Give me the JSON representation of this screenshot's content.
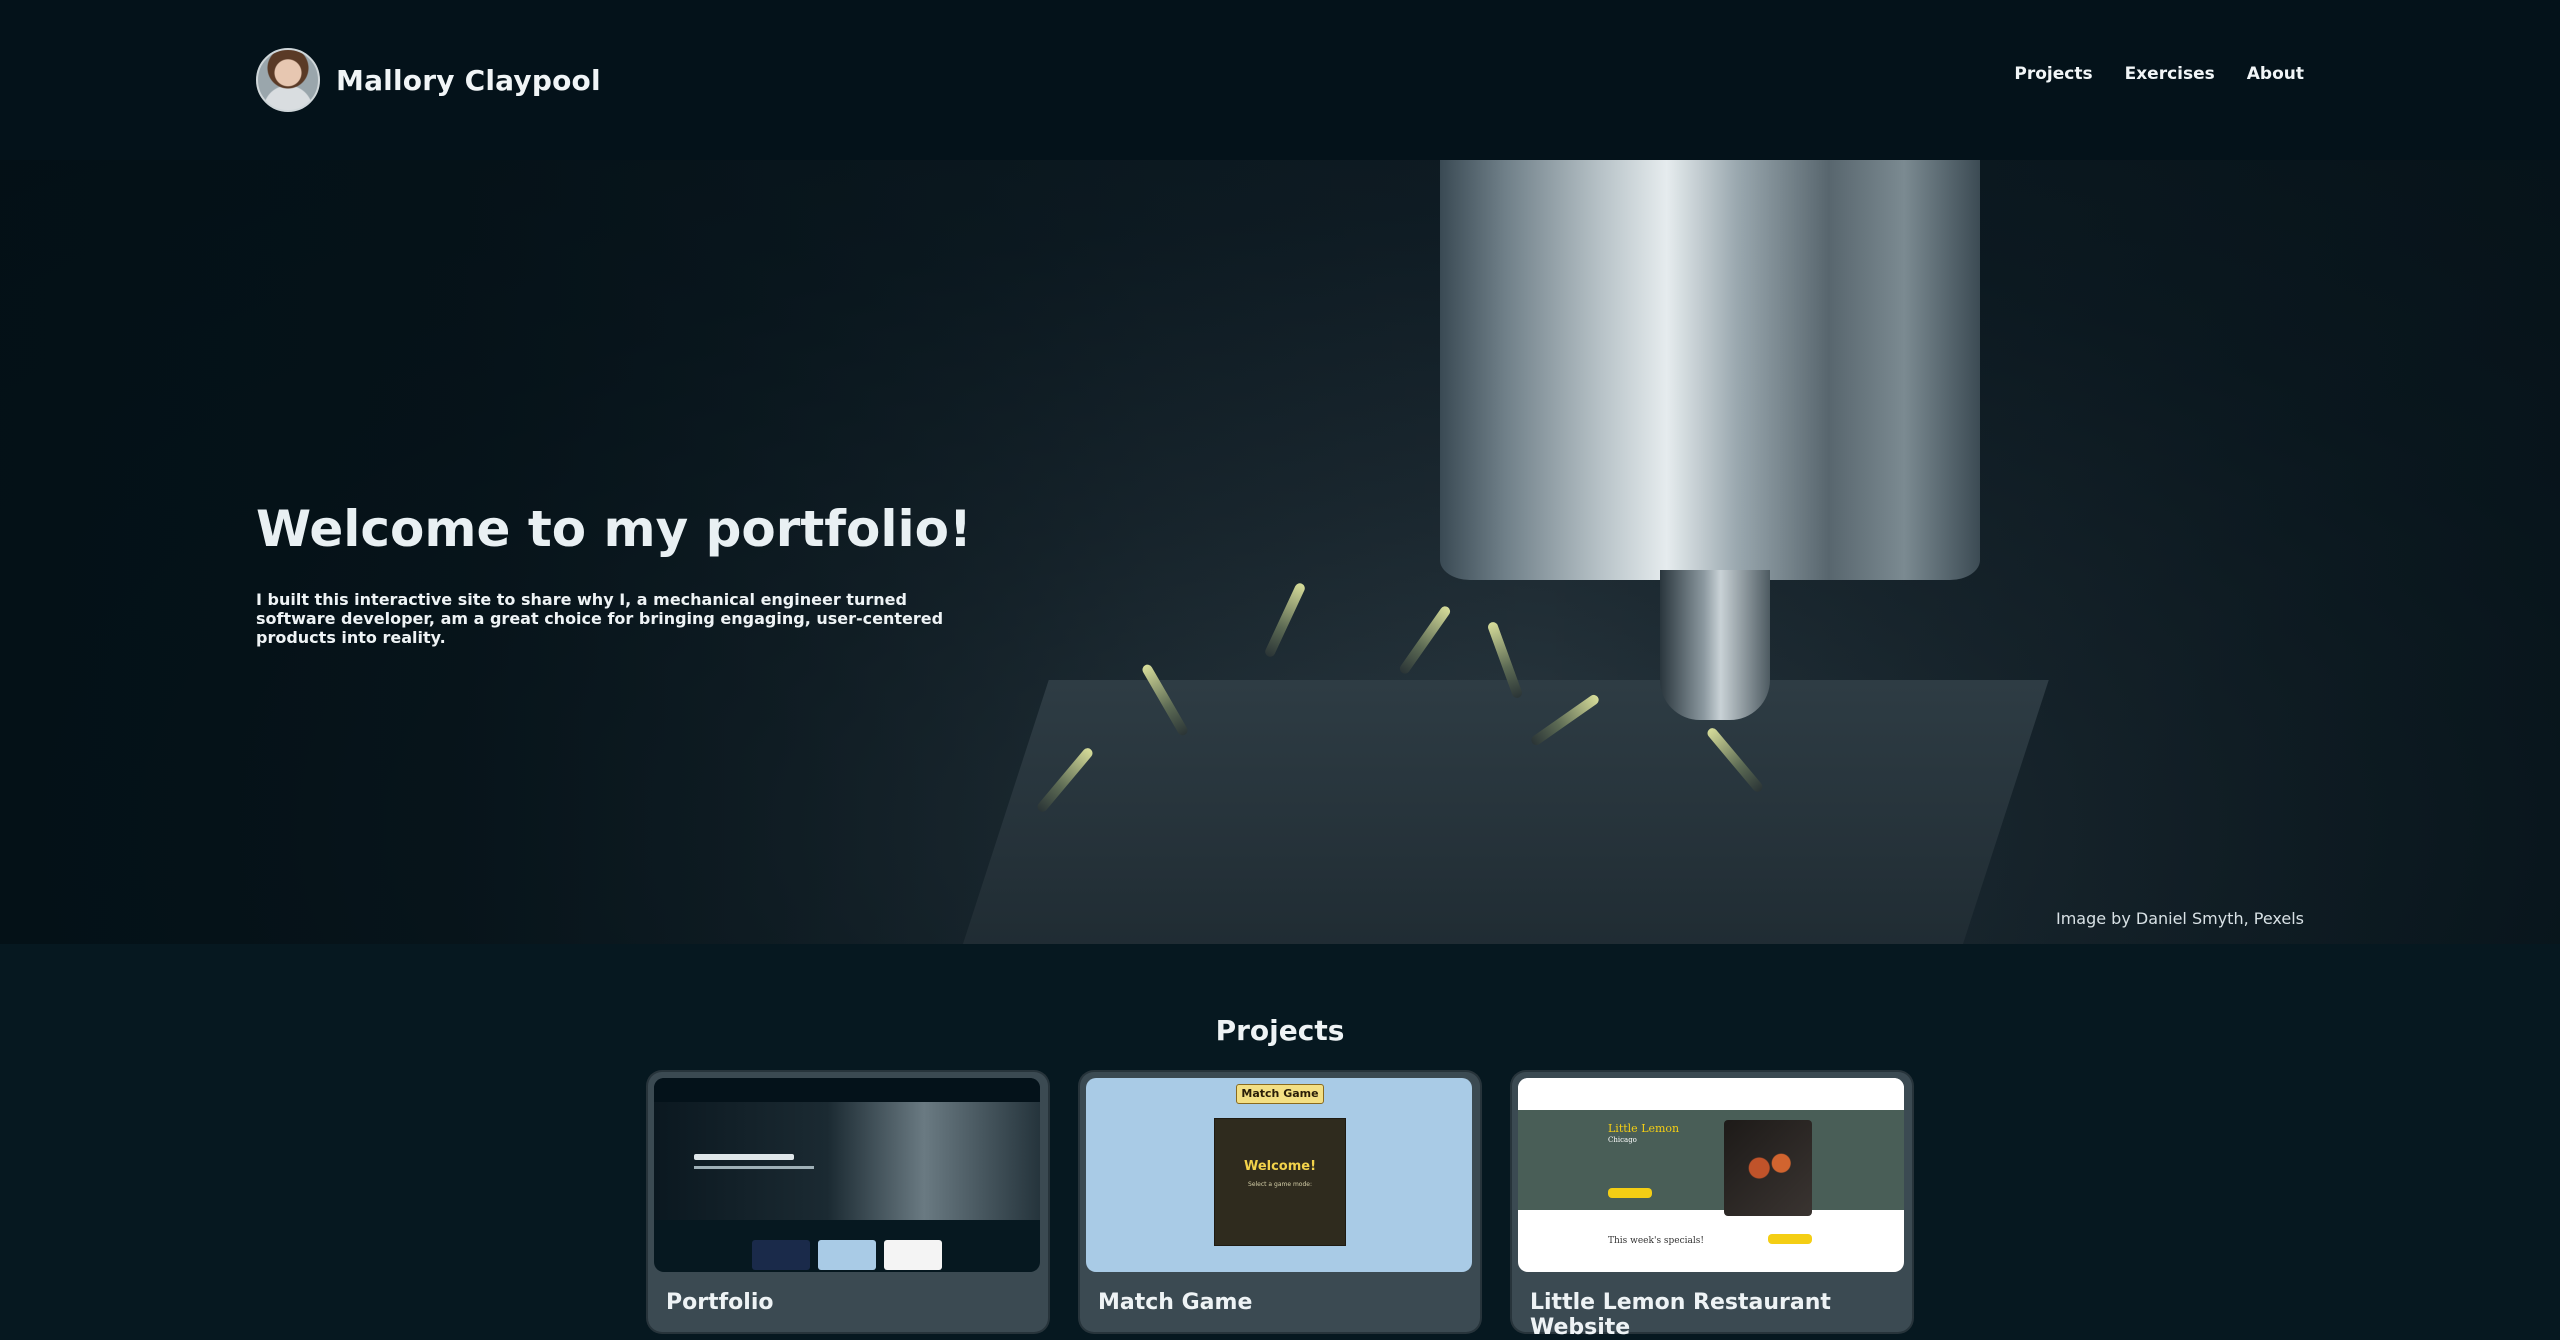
{
  "header": {
    "name": "Mallory Claypool",
    "nav": [
      "Projects",
      "Exercises",
      "About"
    ]
  },
  "hero": {
    "title": "Welcome to my portfolio!",
    "text": "I built this interactive site to share why I, a mechanical engineer turned software developer, am a great choice for bringing engaging, user-centered products into reality.",
    "credit": "Image by Daniel Smyth, Pexels"
  },
  "projects": {
    "title": "Projects",
    "cards": [
      {
        "title": "Portfolio"
      },
      {
        "title": "Match Game",
        "thumb_banner": "Match Game",
        "thumb_welcome": "Welcome!",
        "thumb_sub": "Select a game mode:"
      },
      {
        "title": "Little Lemon Restaurant Website",
        "thumb_brand": "Little Lemon",
        "thumb_city": "Chicago",
        "thumb_specials": "This week's specials!"
      }
    ]
  },
  "colors": {
    "header_bg": "#04121a",
    "page_bg": "#061820",
    "card_bg": "#3b4a52"
  }
}
